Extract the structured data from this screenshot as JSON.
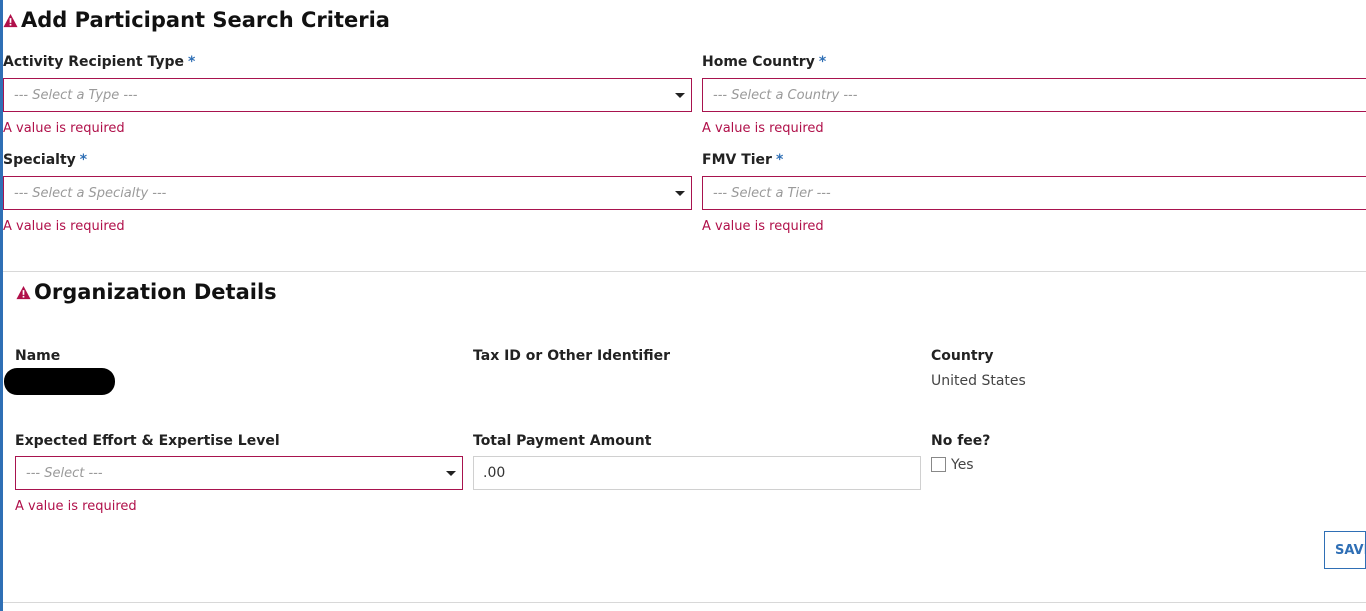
{
  "search_criteria": {
    "title": "Add Participant Search Criteria",
    "required_marker": "*",
    "fields": {
      "recipient_type": {
        "label": "Activity Recipient Type",
        "placeholder": "--- Select a Type ---",
        "error": "A value is required"
      },
      "home_country": {
        "label": "Home Country",
        "placeholder": "--- Select a Country ---",
        "error": "A value is required"
      },
      "specialty": {
        "label": "Specialty",
        "placeholder": "--- Select a Specialty ---",
        "error": "A value is required"
      },
      "fmv_tier": {
        "label": "FMV Tier",
        "placeholder": "--- Select a Tier ---",
        "error": "A value is required"
      }
    }
  },
  "organization": {
    "title": "Organization Details",
    "name_label": "Name",
    "tax_id_label": "Tax ID or Other Identifier",
    "country_label": "Country",
    "country_value": "United States",
    "effort_label": "Expected Effort & Expertise Level",
    "effort_placeholder": "--- Select ---",
    "effort_error": "A value is required",
    "payment_label": "Total Payment Amount",
    "payment_value": ".00",
    "no_fee_label": "No fee?",
    "no_fee_option": "Yes",
    "no_fee_checked": false,
    "save_label": "SAVE"
  },
  "colors": {
    "error": "#b0104a",
    "accent": "#2f6fb5",
    "invalid_border": "#a8134e"
  }
}
